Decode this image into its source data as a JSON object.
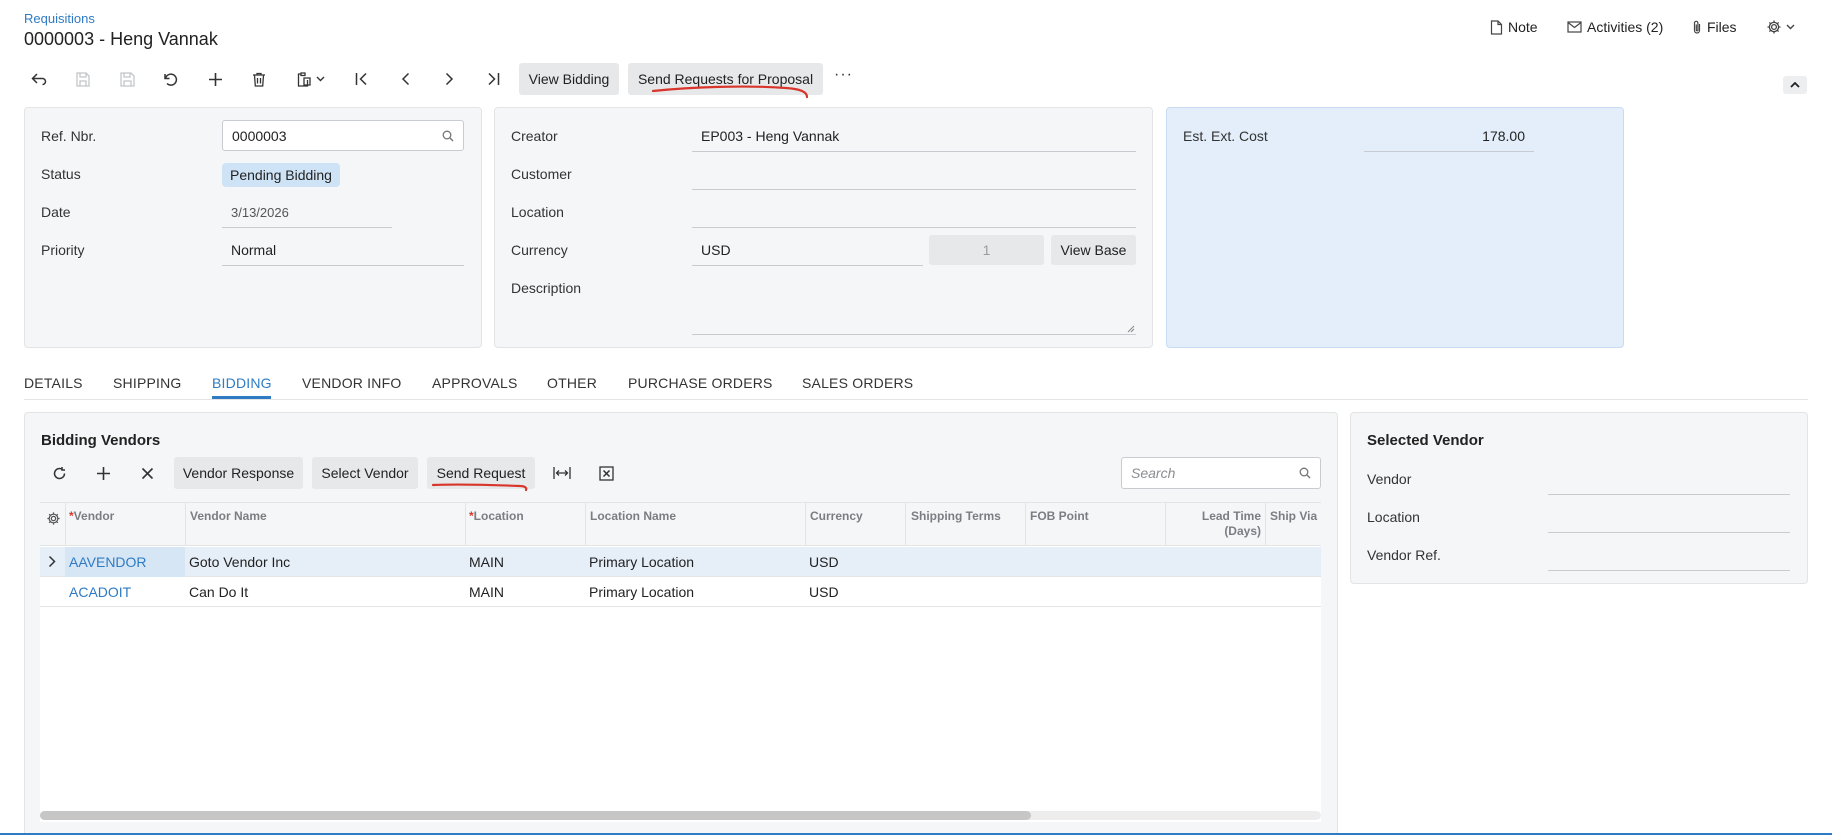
{
  "header": {
    "breadcrumb": "Requisitions",
    "title": "0000003 - Heng Vannak",
    "note_label": "Note",
    "activities_label": "Activities (2)",
    "files_label": "Files"
  },
  "toolbar": {
    "view_bidding": "View Bidding",
    "send_rfp": "Send Requests for Proposal",
    "more": "···"
  },
  "summary": {
    "ref_nbr_label": "Ref. Nbr.",
    "ref_nbr_value": "0000003",
    "status_label": "Status",
    "status_value": "Pending Bidding",
    "date_label": "Date",
    "date_value": "3/13/2026",
    "priority_label": "Priority",
    "priority_value": "Normal",
    "creator_label": "Creator",
    "creator_value": "EP003 - Heng Vannak",
    "customer_label": "Customer",
    "customer_value": "",
    "location_label": "Location",
    "location_value": "",
    "currency_label": "Currency",
    "currency_value": "USD",
    "currency_rate": "1",
    "view_base": "View Base",
    "description_label": "Description",
    "description_value": "",
    "est_cost_label": "Est. Ext. Cost",
    "est_cost_value": "178.00"
  },
  "tabs": [
    "DETAILS",
    "SHIPPING",
    "BIDDING",
    "VENDOR INFO",
    "APPROVALS",
    "OTHER",
    "PURCHASE ORDERS",
    "SALES ORDERS"
  ],
  "active_tab": "BIDDING",
  "bidding": {
    "title": "Bidding Vendors",
    "vendor_response": "Vendor Response",
    "select_vendor": "Select Vendor",
    "send_request": "Send Request",
    "search_placeholder": "Search",
    "columns": {
      "vendor": "Vendor",
      "vendor_name": "Vendor Name",
      "location": "Location",
      "location_name": "Location Name",
      "currency": "Currency",
      "shipping_terms": "Shipping Terms",
      "fob_point": "FOB Point",
      "lead_time_1": "Lead Time",
      "lead_time_2": "(Days)",
      "ship_via": "Ship Via"
    },
    "required_mark": "*",
    "rows": [
      {
        "vendor": "AAVENDOR",
        "vendor_name": "Goto Vendor Inc",
        "location": "MAIN",
        "location_name": "Primary Location",
        "currency": "USD"
      },
      {
        "vendor": "ACADOIT",
        "vendor_name": "Can Do It",
        "location": "MAIN",
        "location_name": "Primary Location",
        "currency": "USD"
      }
    ]
  },
  "selected_vendor": {
    "title": "Selected Vendor",
    "vendor_label": "Vendor",
    "location_label": "Location",
    "vendor_ref_label": "Vendor Ref.",
    "vendor_value": "",
    "location_value": "",
    "vendor_ref_value": ""
  },
  "colors": {
    "accent": "#2e7bc4",
    "status_badge_bg": "#cfe3f7",
    "cost_panel_bg": "#e3eefa",
    "selected_row_bg": "#e6eef8",
    "annotation_red": "#d9352b"
  }
}
